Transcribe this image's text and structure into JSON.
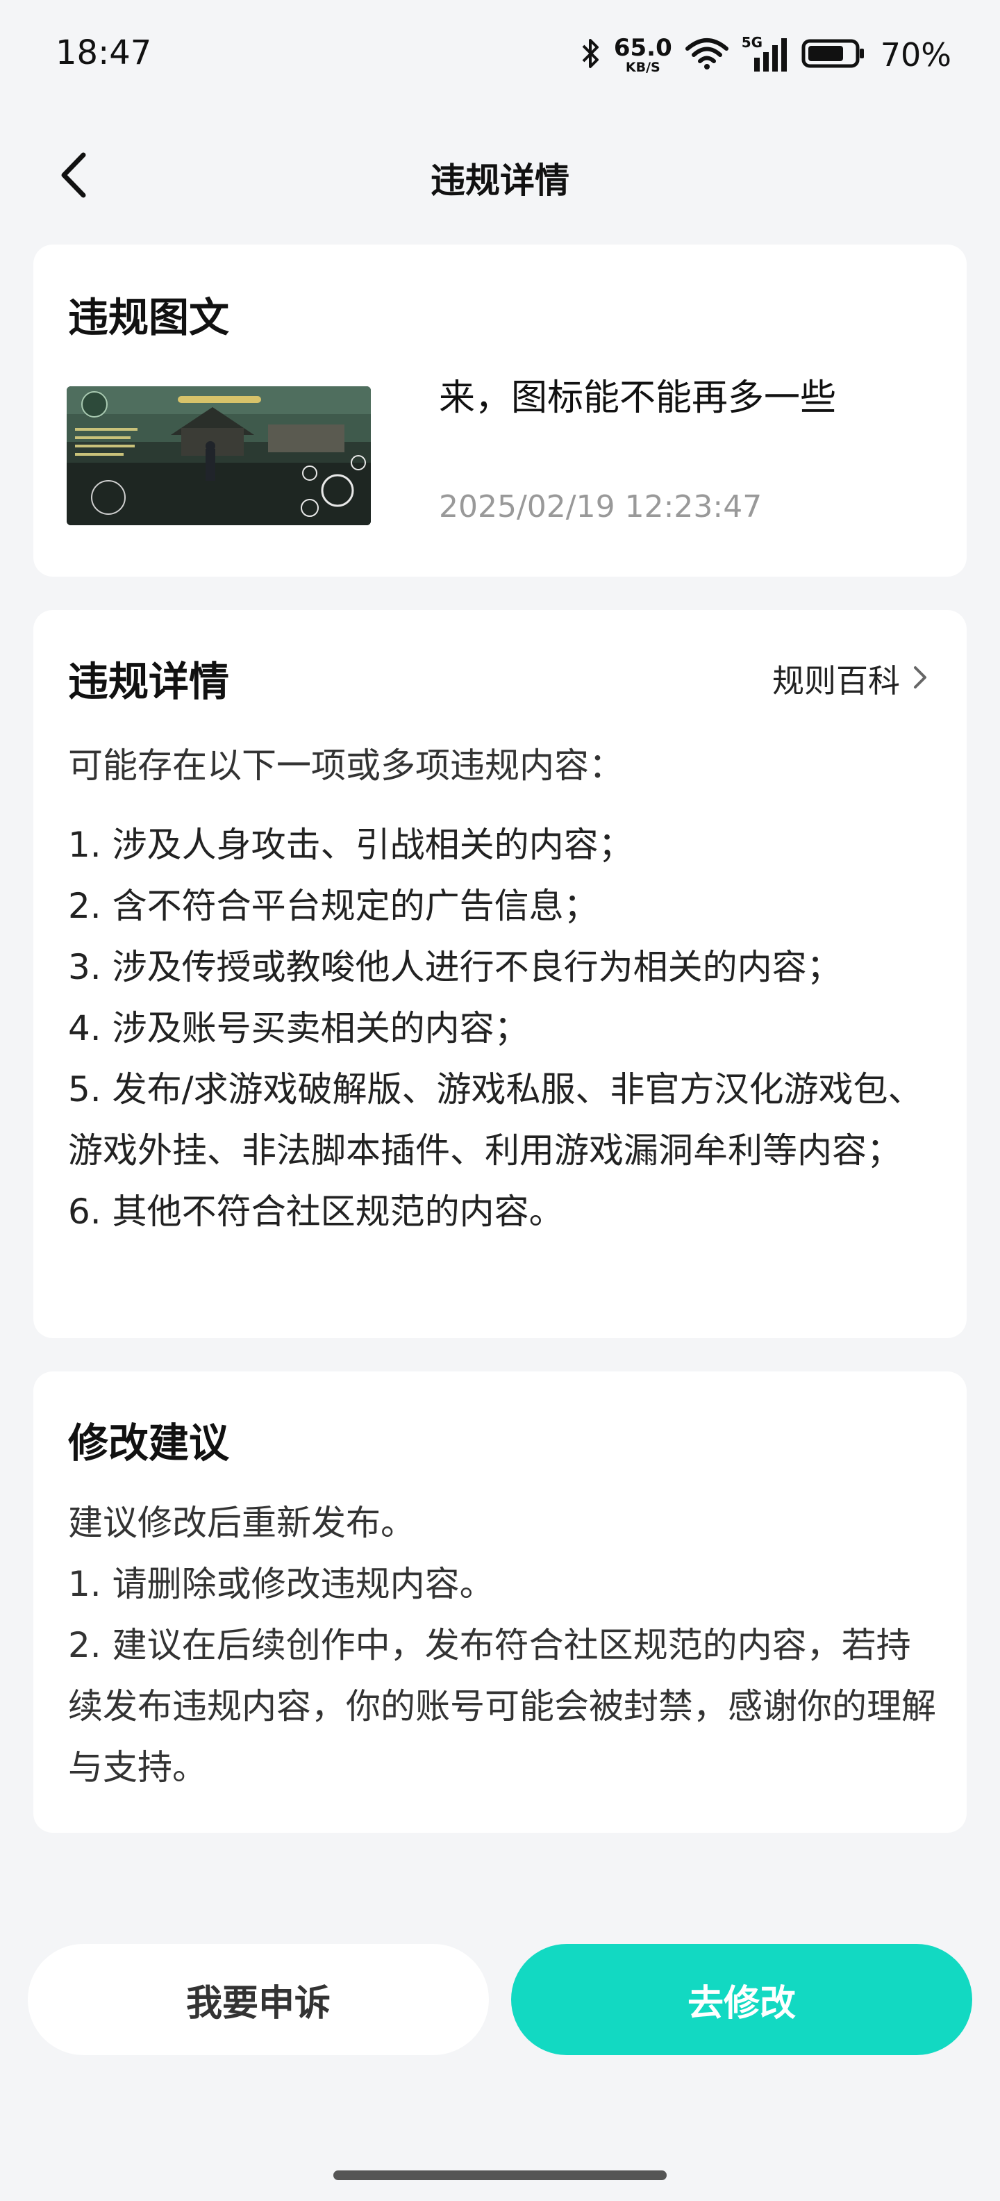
{
  "status_bar": {
    "time": "18:47",
    "net_speed_value": "65.0",
    "net_speed_unit": "KB/S",
    "signal_label": "5G",
    "battery_percent": "70%",
    "icons": [
      "bluetooth-icon",
      "wifi-icon",
      "cellular-signal-icon",
      "battery-icon"
    ]
  },
  "nav": {
    "title": "违规详情",
    "back_icon": "chevron-left-icon"
  },
  "violation_post": {
    "title": "违规图文",
    "text": "来，图标能不能再多一些",
    "timestamp": "2025/02/19 12:23:47"
  },
  "violation_details": {
    "title": "违规详情",
    "rules_link": "规则百科",
    "lead": "可能存在以下一项或多项违规内容：",
    "items": [
      "1. 涉及人身攻击、引战相关的内容；",
      "2. 含不符合平台规定的广告信息；",
      "3. 涉及传授或教唆他人进行不良行为相关的内容；",
      "4. 涉及账号买卖相关的内容；",
      "5. 发布/求游戏破解版、游戏私服、非官方汉化游戏包、游戏外挂、非法脚本插件、利用游戏漏洞牟利等内容；",
      "6. 其他不符合社区规范的内容。"
    ]
  },
  "suggestion": {
    "title": "修改建议",
    "lines": [
      "建议修改后重新发布。",
      "1. 请删除或修改违规内容。",
      "2. 建议在后续创作中，发布符合社区规范的内容，若持续发布违规内容，你的账号可能会被封禁，感谢你的理解与支持。"
    ]
  },
  "actions": {
    "appeal_label": "我要申诉",
    "edit_label": "去修改"
  },
  "colors": {
    "accent": "#12d9c2",
    "page_bg": "#f4f5f7",
    "card_bg": "#ffffff",
    "muted_text": "#999999"
  }
}
